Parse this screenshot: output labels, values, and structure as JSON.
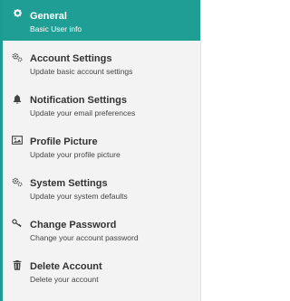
{
  "colors": {
    "accent": "#1f9e96",
    "menu_bg": "#f3f3f3",
    "text": "#333333"
  },
  "menu": {
    "items": [
      {
        "icon": "gear-icon",
        "title": "General",
        "subtitle": "Basic User info",
        "active": true
      },
      {
        "icon": "gears-icon",
        "title": "Account Settings",
        "subtitle": "Update basic account settings",
        "active": false
      },
      {
        "icon": "bell-icon",
        "title": "Notification Settings",
        "subtitle": "Update your email preferences",
        "active": false
      },
      {
        "icon": "picture-icon",
        "title": "Profile Picture",
        "subtitle": "Update your profile picture",
        "active": false
      },
      {
        "icon": "gears-icon",
        "title": "System Settings",
        "subtitle": "Update your system defaults",
        "active": false
      },
      {
        "icon": "key-icon",
        "title": "Change Password",
        "subtitle": "Change your account password",
        "active": false
      },
      {
        "icon": "trash-icon",
        "title": "Delete Account",
        "subtitle": "Delete your account",
        "active": false
      }
    ]
  }
}
